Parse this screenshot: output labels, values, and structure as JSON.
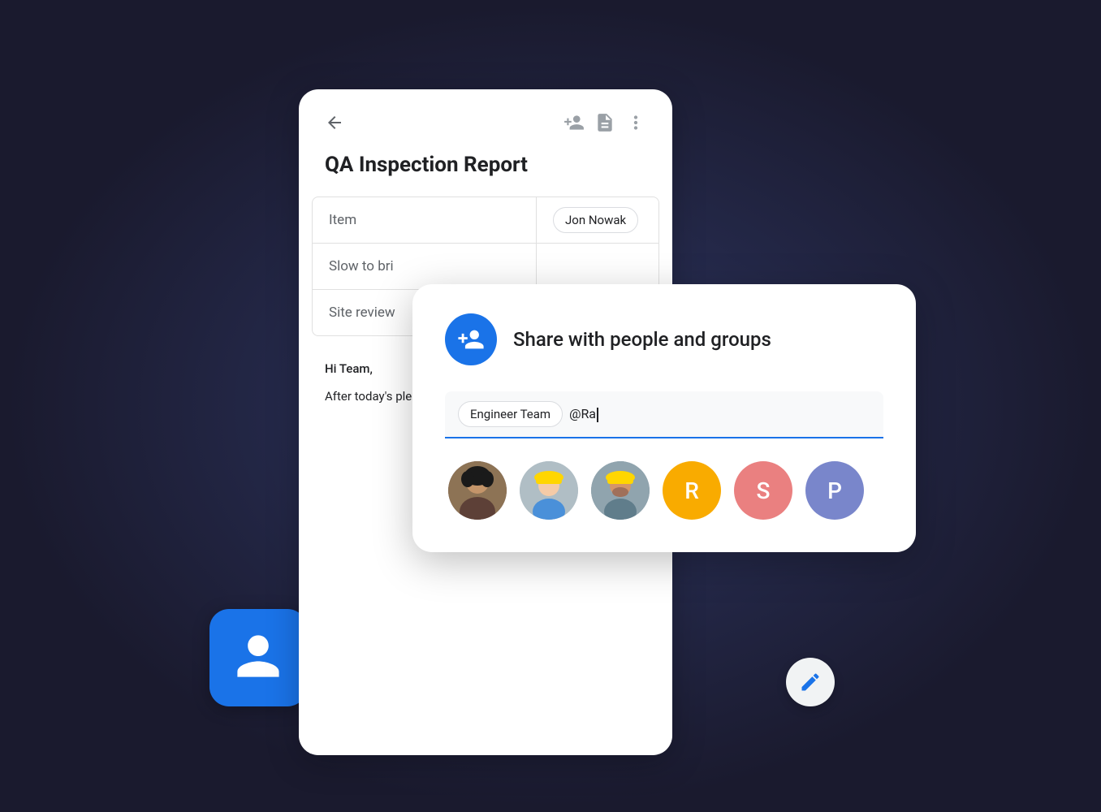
{
  "scene": {
    "background": "#1a1a2e"
  },
  "doc_card": {
    "title": "QA Inspection Report",
    "nav": {
      "back_label": "back",
      "add_person_label": "add person",
      "doc_label": "document",
      "more_label": "more options"
    },
    "table": {
      "rows": [
        {
          "left": "Item",
          "right": "Jon Nowak",
          "has_chip": true
        },
        {
          "left": "Slow to bri",
          "right": "",
          "has_chip": false
        },
        {
          "left": "Site review",
          "right": "",
          "has_chip": false
        }
      ]
    },
    "body": {
      "greeting": "Hi Team,",
      "paragraph": "After today's please add y working doc before next week."
    }
  },
  "share_dialog": {
    "title": "Share with people and groups",
    "chip_label": "Engineer Team",
    "input_text": "@Ra",
    "avatars": [
      {
        "type": "photo",
        "id": "person1",
        "color": "#8d6e63",
        "label": "Person 1"
      },
      {
        "type": "photo",
        "id": "person2",
        "color": "#90a4ae",
        "label": "Person 2"
      },
      {
        "type": "photo",
        "id": "person3",
        "color": "#78909c",
        "label": "Person 3"
      },
      {
        "type": "letter",
        "letter": "R",
        "color": "#f9ab00",
        "label": "R person"
      },
      {
        "type": "letter",
        "letter": "S",
        "color": "#ea8080",
        "label": "S person"
      },
      {
        "type": "letter",
        "letter": "P",
        "color": "#7986cb",
        "label": "P person"
      }
    ]
  },
  "blue_card": {
    "label": "person icon card"
  },
  "fab": {
    "label": "edit",
    "icon": "pencil"
  }
}
